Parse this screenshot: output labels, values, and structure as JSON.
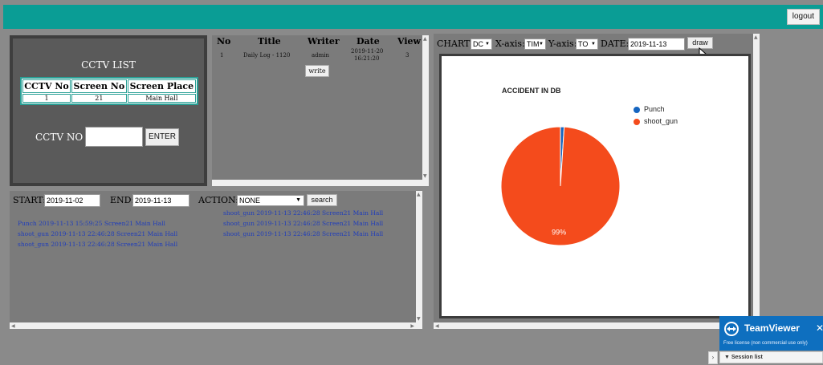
{
  "header": {
    "logout_label": "logout"
  },
  "cctv": {
    "title": "CCTV LIST",
    "columns": [
      "CCTV No",
      "Screen No",
      "Screen Place"
    ],
    "rows": [
      [
        "1",
        "21",
        "Main Hall"
      ]
    ],
    "no_label": "CCTV NO :",
    "input_value": "",
    "enter_label": "ENTER"
  },
  "board": {
    "columns": [
      "No",
      "Title",
      "Writer",
      "Date",
      "View"
    ],
    "rows": [
      {
        "no": "1",
        "title": "Daily Log - 1120",
        "writer": "admin",
        "date_line1": "2019-11-20",
        "date_line2": "16:21:20",
        "view": "3"
      }
    ],
    "write_label": "write"
  },
  "logs": {
    "start_label": "START:",
    "start_value": "2019-11-02",
    "end_label": "END:",
    "end_value": "2019-11-13",
    "action_label": "ACTION:",
    "action_value": "NONE",
    "search_label": "search",
    "left_entries": [
      "Punch 2019-11-13 15:59:25 Screen21 Main Hall",
      "shoot_gun 2019-11-13 22:46:28 Screen21 Main Hall",
      "shoot_gun 2019-11-13 22:46:28 Screen21 Main Hall"
    ],
    "right_entries": [
      "shoot_gun 2019-11-13 22:46:28 Screen21 Main Hall",
      "shoot_gun 2019-11-13 22:46:28 Screen21 Main Hall",
      "shoot_gun 2019-11-13 22:46:28 Screen21 Main Hall"
    ]
  },
  "chart_controls": {
    "chart_label": "CHART:",
    "chart_value": "DC",
    "xaxis_label": "X-axis:",
    "xaxis_value": "TIM",
    "yaxis_label": "Y-axis:",
    "yaxis_value": "TO",
    "date_label": "DATE:",
    "date_value": "2019-11-13",
    "draw_label": "draw"
  },
  "chart_data": {
    "type": "pie",
    "title": "ACCIDENT IN DB",
    "categories": [
      "Punch",
      "shoot_gun"
    ],
    "values": [
      1,
      99
    ],
    "colors": [
      "#1565c0",
      "#f44b1c"
    ],
    "slice_labels": [
      "",
      "99%"
    ],
    "legend": "right"
  },
  "teamviewer": {
    "name": "TeamViewer",
    "close": "✕",
    "free_text": "Free license (non commercial use only)",
    "session_label": "▼  Session list",
    "side_arrow": "›"
  }
}
